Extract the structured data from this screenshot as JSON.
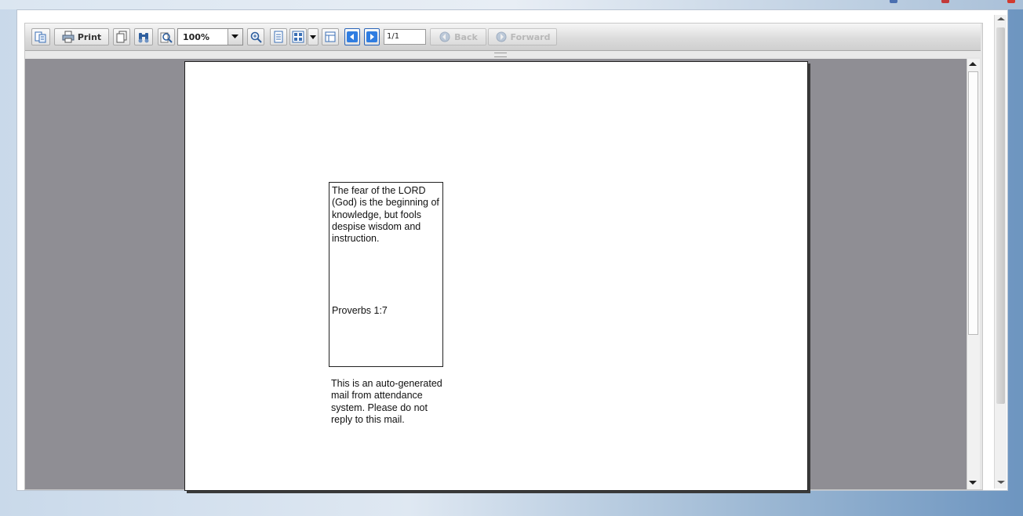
{
  "toolbar": {
    "print_label": "Print",
    "zoom_value": "100%",
    "page_value": "1/1",
    "back_label": "Back",
    "forward_label": "Forward"
  },
  "document": {
    "quote_text": "The fear of the LORD (God) is the beginning of knowledge, but fools despise wisdom and instruction.",
    "quote_reference": "Proverbs 1:7",
    "footer_note": "This is an auto-generated mail from attendance system. Please do not reply to this mail."
  },
  "colors": {
    "doc_background": "#8f8e94",
    "nav_button": "#2f7de1"
  }
}
